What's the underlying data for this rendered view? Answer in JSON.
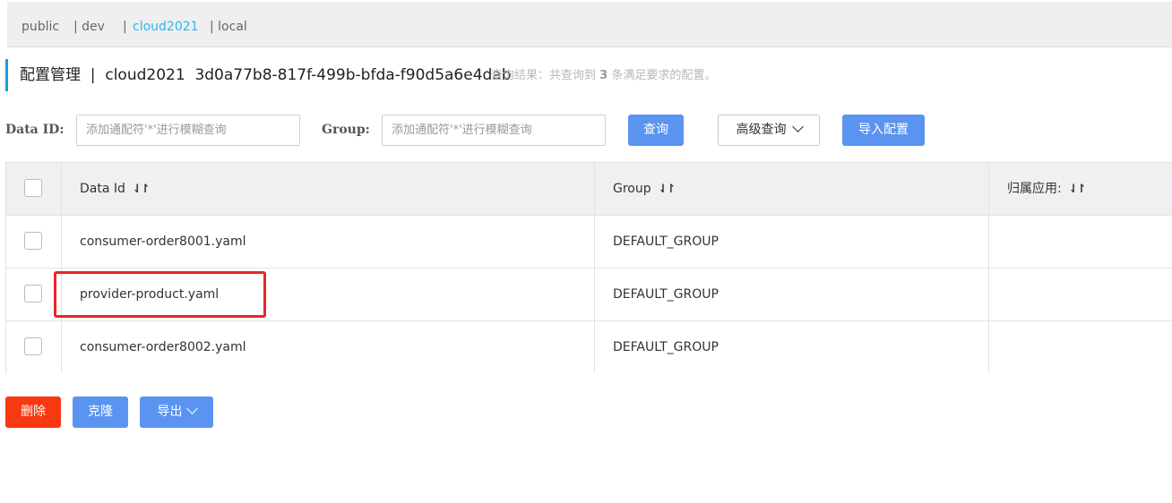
{
  "namespaces": [
    {
      "label": "public",
      "active": false
    },
    {
      "label": "| dev",
      "active": false
    },
    {
      "label": "|",
      "active": false
    },
    {
      "label": "cloud2021",
      "active": true
    },
    {
      "label": "| local",
      "active": false
    }
  ],
  "title": "配置管理  |  cloud2021  3d0a77b8-817f-499b-bfda-f90d5a6e4dab",
  "result": {
    "prefix": "查询结果：共查询到 ",
    "count": "3",
    "suffix": " 条满足要求的配置。"
  },
  "search": {
    "data_id_label": "Data ID:",
    "data_id_placeholder": "添加通配符'*'进行模糊查询",
    "group_label": "Group:",
    "group_placeholder": "添加通配符'*'进行模糊查询",
    "query_button": "查询",
    "advanced_button": "高级查询",
    "import_button": "导入配置"
  },
  "table": {
    "headers": [
      "Data Id",
      "Group",
      "归属应用:"
    ],
    "sort_icon": "⇃↾",
    "rows": [
      {
        "data_id": "consumer-order8001.yaml",
        "group": "DEFAULT_GROUP",
        "app": ""
      },
      {
        "data_id": "provider-product.yaml",
        "group": "DEFAULT_GROUP",
        "app": ""
      },
      {
        "data_id": "consumer-order8002.yaml",
        "group": "DEFAULT_GROUP",
        "app": ""
      }
    ]
  },
  "actions": {
    "delete": "删除",
    "clone": "克隆",
    "export": "导出"
  },
  "colors": {
    "accent": "#5a94f0",
    "danger": "#f73911",
    "active_tab": "#29b6f6",
    "highlight": "#e8252a"
  }
}
